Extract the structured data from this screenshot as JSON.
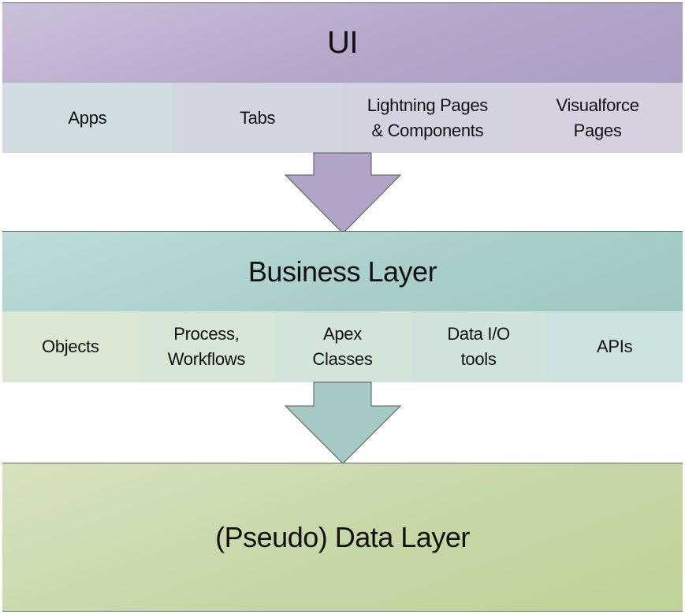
{
  "layers": [
    {
      "title": "UI",
      "color": "#b4a6c8",
      "components": [
        {
          "label": "Apps"
        },
        {
          "label": "Tabs"
        },
        {
          "label": "Lightning Pages\n& Components"
        },
        {
          "label": "Visualforce\nPages"
        }
      ]
    },
    {
      "title": "Business Layer",
      "color": "#a4cbc6",
      "components": [
        {
          "label": "Objects"
        },
        {
          "label": "Process,\nWorkflows"
        },
        {
          "label": "Apex\nClasses"
        },
        {
          "label": "Data I/O\ntools"
        },
        {
          "label": "APIs"
        }
      ]
    },
    {
      "title": "(Pseudo) Data Layer",
      "color": "#c3d4a0"
    }
  ],
  "arrows": [
    {
      "from": "UI",
      "to": "Business Layer",
      "color": "#b2a4c7"
    },
    {
      "from": "Business Layer",
      "to": "(Pseudo) Data Layer",
      "color": "#a5cac6"
    }
  ]
}
